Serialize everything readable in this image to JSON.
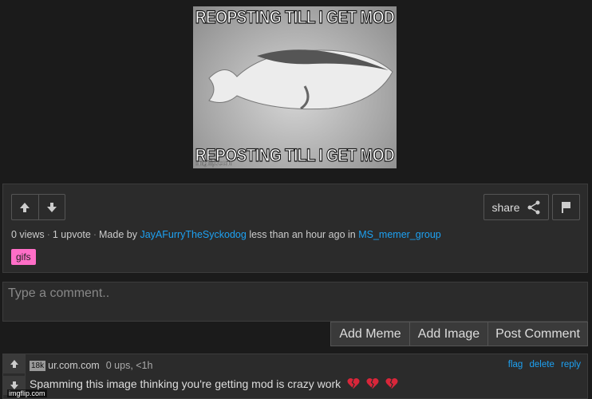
{
  "meme": {
    "top_caption": "REOPSTING TILL I GET MOD",
    "bottom_caption": "REPOSTING TILL I GET MOD",
    "watermark": "imgflip.com"
  },
  "post": {
    "views": "0 views",
    "upvotes": "1 upvote",
    "made_by_label": "Made by",
    "author": "JayAFurryTheSyckodog",
    "time_text": "less than an hour ago in",
    "stream": "MS_memer_group",
    "tag": "gifs",
    "share_label": "share",
    "tag_color": "#ff6ec7",
    "link_color": "#1da1f2"
  },
  "comment_form": {
    "placeholder": "Type a comment..",
    "add_meme": "Add Meme",
    "add_image": "Add Image",
    "post_comment": "Post Comment"
  },
  "comment": {
    "points_badge": "18k",
    "username": "ur.com.com",
    "stats": "0 ups, <1h",
    "flag": "flag",
    "delete": "delete",
    "reply": "reply",
    "text": "Spamming this image thinking you're getting mod is crazy work"
  },
  "footer": {
    "watermark": "imgflip.com"
  }
}
